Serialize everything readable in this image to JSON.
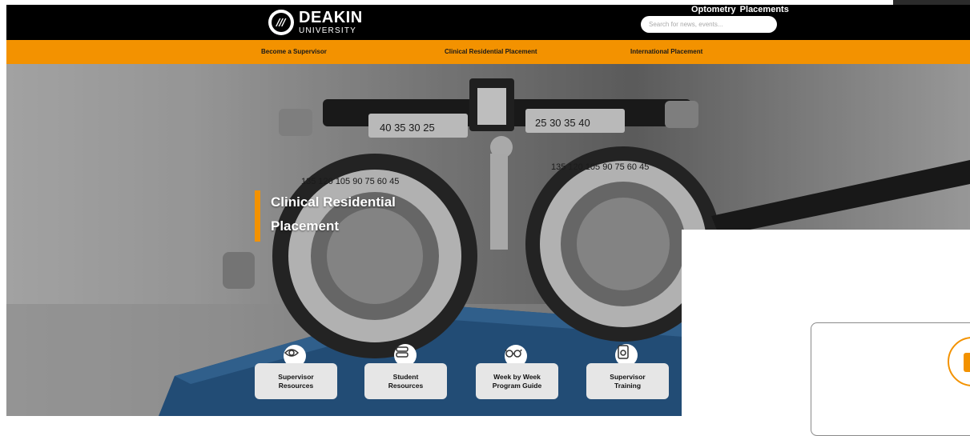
{
  "brand": {
    "name": "DEAKIN",
    "sub": "UNIVERSITY",
    "color_orange": "#f39200"
  },
  "header": {
    "site_title": "Optometry  Placements",
    "search_placeholder": "Search for news, events..."
  },
  "nav": {
    "items": [
      {
        "label": "Become a Supervisor"
      },
      {
        "label": "Clinical Residential Placement"
      },
      {
        "label": "International Placement"
      }
    ]
  },
  "hero": {
    "headline_line1": "Clinical Residential",
    "headline_line2": "Placement",
    "tiles": [
      {
        "label_line1": "Supervisor",
        "label_line2": "Resources",
        "icon": "eye-icon"
      },
      {
        "label_line1": "Student",
        "label_line2": "Resources",
        "icon": "book-stack-icon"
      },
      {
        "label_line1": "Week by Week",
        "label_line2": "Program Guide",
        "icon": "glasses-icon"
      },
      {
        "label_line1": "Supervisor",
        "label_line2": "Training",
        "icon": "screen-icon"
      }
    ]
  }
}
